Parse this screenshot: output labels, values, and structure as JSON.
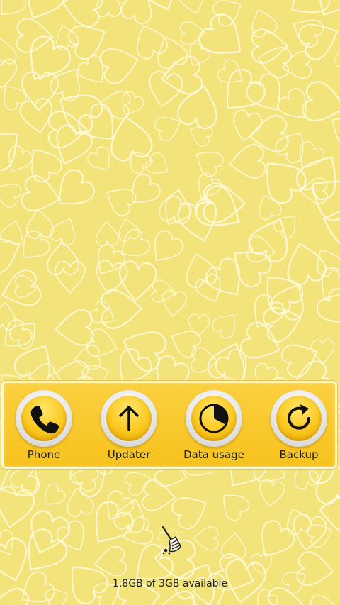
{
  "dock": {
    "apps": [
      {
        "label": "Phone",
        "icon": "phone-icon"
      },
      {
        "label": "Updater",
        "icon": "arrow-up-icon"
      },
      {
        "label": "Data usage",
        "icon": "pie-chart-icon"
      },
      {
        "label": "Backup",
        "icon": "refresh-icon"
      }
    ]
  },
  "cleaner": {
    "icon": "broom-icon"
  },
  "storage": {
    "text": "1.8GB of 3GB available"
  },
  "colors": {
    "wallpaper": "#f2e37a",
    "dock": "#f7c21d",
    "icon_core": "#fbc81f"
  }
}
